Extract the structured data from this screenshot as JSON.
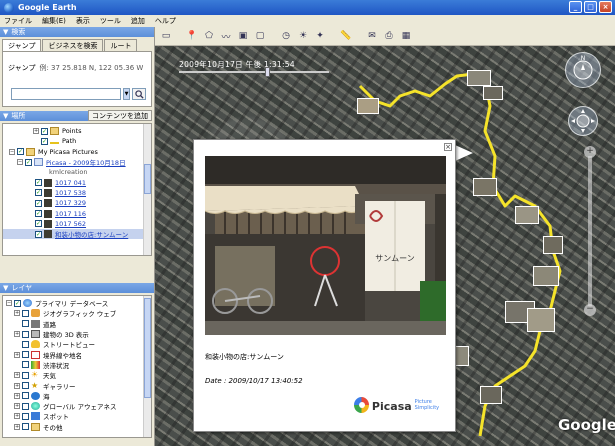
{
  "window": {
    "title": "Google Earth"
  },
  "menu": [
    "ファイル",
    "編集(E)",
    "表示",
    "ツール",
    "追加",
    "ヘルプ"
  ],
  "search": {
    "header": "検索",
    "tabs": [
      "ジャンプ",
      "ビジネスを検索",
      "ルート"
    ],
    "label": "ジャンプ",
    "example": "例: 37 25.818 N, 122 05.36 W",
    "input_value": "",
    "search_icon": "magnifier-icon"
  },
  "places": {
    "header": "場所",
    "add_content": "コンテンツを追加",
    "items": [
      {
        "label": "Points",
        "type": "folder"
      },
      {
        "label": "Path",
        "type": "path"
      },
      {
        "label": "My Picasa Pictures",
        "type": "folder"
      },
      {
        "label": "Picasa - 2009年10月18日",
        "type": "link"
      },
      {
        "label": "kmlcreation",
        "type": "gray"
      },
      {
        "label": "1017 041",
        "type": "link"
      },
      {
        "label": "1017 538",
        "type": "link"
      },
      {
        "label": "1017 329",
        "type": "link"
      },
      {
        "label": "1017 116",
        "type": "link"
      },
      {
        "label": "1017 562",
        "type": "link"
      },
      {
        "label": "和装小物の店:サンムーン",
        "type": "link"
      }
    ]
  },
  "layers": {
    "header": "レイヤ",
    "items": [
      {
        "label": "プライマリ データベース"
      },
      {
        "label": "ジオグラフィック ウェブ"
      },
      {
        "label": "道路"
      },
      {
        "label": "建物の 3D 表示"
      },
      {
        "label": "ストリートビュー"
      },
      {
        "label": "境界線や地名"
      },
      {
        "label": "渋滞状況"
      },
      {
        "label": "天気"
      },
      {
        "label": "ギャラリー"
      },
      {
        "label": "海"
      },
      {
        "label": "グローバル アウェアネス"
      },
      {
        "label": "スポット"
      },
      {
        "label": "その他"
      }
    ]
  },
  "map": {
    "timestamp": "2009年10月17日 午後 1:31:54",
    "google_logo": "Google",
    "eye_alt": "",
    "route_color": "#f5e32a"
  },
  "popup": {
    "caption": "和装小物の店:サンムーン",
    "date": "Date : 2009/10/17 13:40:52",
    "brand": "Picasa",
    "tagline": "Picture Simplicity",
    "shop_sign": "サンムーン"
  }
}
